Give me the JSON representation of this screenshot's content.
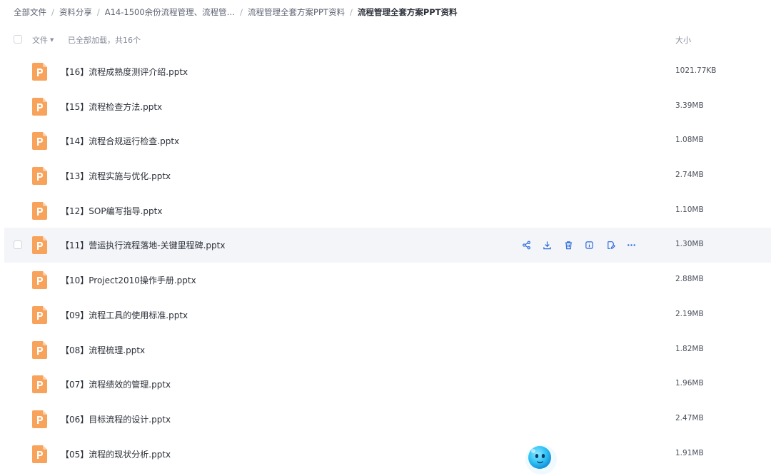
{
  "breadcrumb": {
    "items": [
      "全部文件",
      "资料分享",
      "A14-1500余份流程管理、流程管…",
      "流程管理全套方案PPT资料"
    ],
    "current": "流程管理全套方案PPT资料"
  },
  "header": {
    "file_label": "文件",
    "status": "已全部加载，共16个",
    "size_label": "大小"
  },
  "files": [
    {
      "name": "【16】流程成熟度测评介绍.pptx",
      "size": "1021.77KB"
    },
    {
      "name": "【15】流程检查方法.pptx",
      "size": "3.39MB"
    },
    {
      "name": "【14】流程合规运行检查.pptx",
      "size": "1.08MB"
    },
    {
      "name": "【13】流程实施与优化.pptx",
      "size": "2.74MB"
    },
    {
      "name": "【12】SOP编写指导.pptx",
      "size": "1.10MB"
    },
    {
      "name": "【11】营运执行流程落地-关键里程碑.pptx",
      "size": "1.30MB"
    },
    {
      "name": "【10】Project2010操作手册.pptx",
      "size": "2.88MB"
    },
    {
      "name": "【09】流程工具的使用标准.pptx",
      "size": "2.19MB"
    },
    {
      "name": "【08】流程梳理.pptx",
      "size": "1.82MB"
    },
    {
      "name": "【07】流程绩效的管理.pptx",
      "size": "1.96MB"
    },
    {
      "name": "【06】目标流程的设计.pptx",
      "size": "2.47MB"
    },
    {
      "name": "【05】流程的现状分析.pptx",
      "size": "1.91MB"
    }
  ],
  "hovered_row_index": 5,
  "row_actions": [
    "share-icon",
    "download-icon",
    "delete-icon",
    "info-icon",
    "edit-icon",
    "more-icon"
  ],
  "colors": {
    "accent": "#2f6bdc",
    "ppt_icon": "#f7a35c",
    "hover_bg": "#f3f5f9"
  }
}
